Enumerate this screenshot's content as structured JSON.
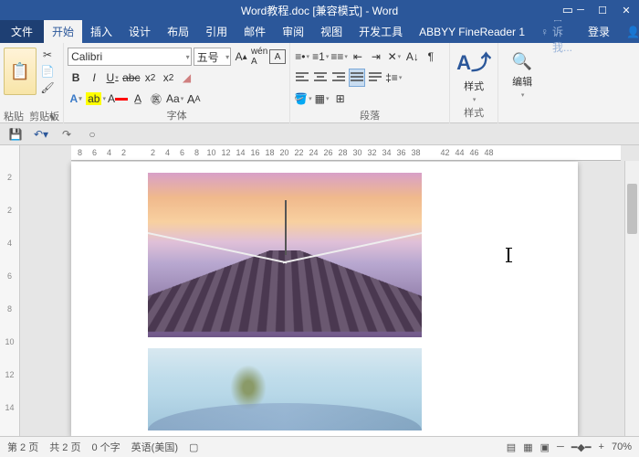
{
  "title": "Word教程.doc [兼容模式] - Word",
  "tabs": {
    "file": "文件",
    "home": "开始",
    "insert": "插入",
    "design": "设计",
    "layout": "布局",
    "references": "引用",
    "mailings": "邮件",
    "review": "审阅",
    "view": "视图",
    "developer": "开发工具",
    "addin": "ABBYY FineReader 1"
  },
  "tellme": "告诉我...",
  "login": "登录",
  "share": "共享",
  "groups": {
    "clipboard": "剪贴板",
    "font": "字体",
    "paragraph": "段落",
    "styles": "样式",
    "editing": "编辑"
  },
  "clipboard": {
    "paste": "粘贴"
  },
  "font": {
    "name": "Calibri",
    "size": "五号"
  },
  "styles": {
    "label": "样式"
  },
  "editing": {
    "label": "编辑"
  },
  "hruler": [
    "8",
    "6",
    "4",
    "2",
    "",
    "2",
    "4",
    "6",
    "8",
    "10",
    "12",
    "14",
    "16",
    "18",
    "20",
    "22",
    "24",
    "26",
    "28",
    "30",
    "32",
    "34",
    "36",
    "38",
    "",
    "42",
    "44",
    "46",
    "48"
  ],
  "vruler": [
    "2",
    "2",
    "4",
    "6",
    "8",
    "10",
    "12",
    "14"
  ],
  "status": {
    "page": "第 2 页",
    "pages": "共 2 页",
    "words": "0 个字",
    "lang": "英语(美国)",
    "zoom": "70%"
  }
}
